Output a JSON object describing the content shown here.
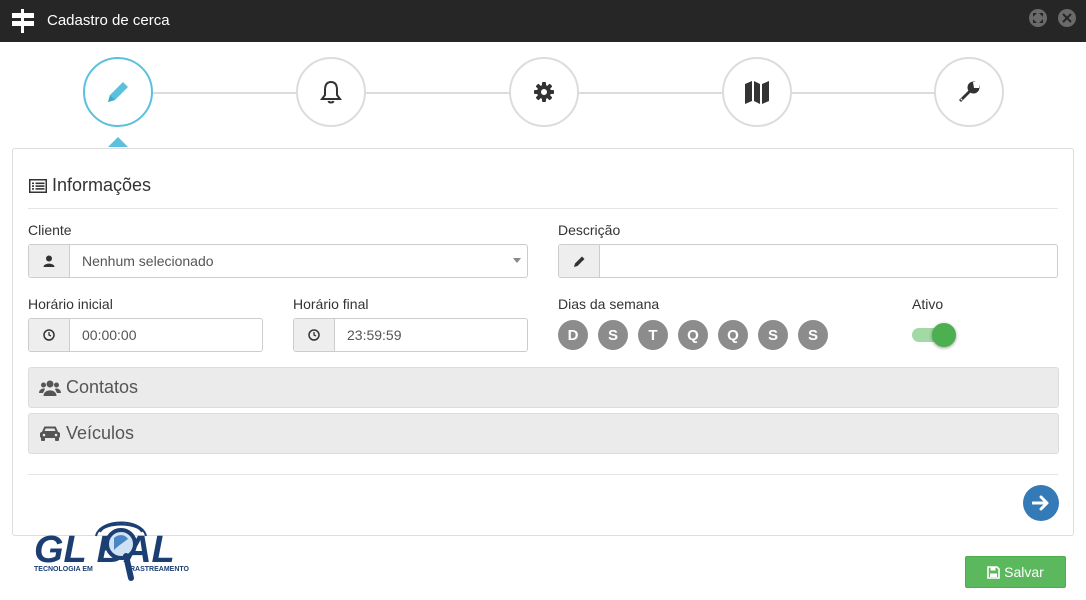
{
  "window": {
    "title": "Cadastro de cerca",
    "app_icon": "signpost-icon"
  },
  "steps": [
    {
      "icon": "pencil-icon",
      "active": true
    },
    {
      "icon": "bell-icon",
      "active": false
    },
    {
      "icon": "gear-icon",
      "active": false
    },
    {
      "icon": "map-icon",
      "active": false
    },
    {
      "icon": "wrench-icon",
      "active": false
    }
  ],
  "info": {
    "heading": "Informações",
    "cliente_label": "Cliente",
    "cliente_value": "Nenhum selecionado",
    "descricao_label": "Descrição",
    "descricao_value": "",
    "horario_inicial_label": "Horário inicial",
    "horario_inicial_value": "00:00:00",
    "horario_final_label": "Horário final",
    "horario_final_value": "23:59:59",
    "dias_label": "Dias da semana",
    "dias": [
      "D",
      "S",
      "T",
      "Q",
      "Q",
      "S",
      "S"
    ],
    "ativo_label": "Ativo",
    "ativo_on": true
  },
  "sections": {
    "contatos": "Contatos",
    "veiculos": "Veículos"
  },
  "logo": {
    "brand": "GL    BAL",
    "tagline_left": "TECNOLOGIA EM",
    "tagline_right": "RASTREAMENTO"
  },
  "buttons": {
    "save": "Salvar"
  },
  "colors": {
    "accent": "#5bc0de",
    "primary": "#337ab7",
    "success": "#5cb85c",
    "titlebar": "#262626",
    "logo": "#1b3f73"
  }
}
